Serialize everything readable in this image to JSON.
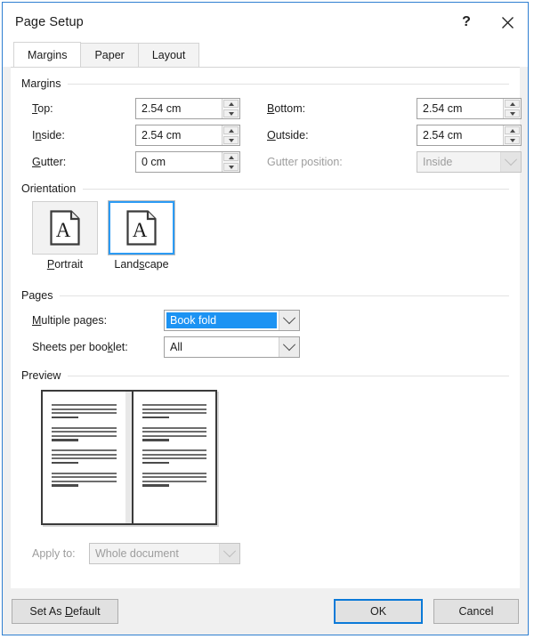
{
  "window": {
    "title": "Page Setup",
    "help_label": "?",
    "close_label": "✕"
  },
  "tabs": [
    {
      "label": "Margins",
      "active": true
    },
    {
      "label": "Paper",
      "active": false
    },
    {
      "label": "Layout",
      "active": false
    }
  ],
  "margins_group": {
    "title": "Margins",
    "fields": {
      "top": {
        "label_pre": "T",
        "label_key": "",
        "label": "Top:",
        "value": "2.54 cm"
      },
      "bottom": {
        "label": "Bottom:",
        "value": "2.54 cm"
      },
      "inside": {
        "label": "Inside:",
        "value": "2.54 cm"
      },
      "outside": {
        "label": "Outside:",
        "value": "2.54 cm"
      },
      "gutter": {
        "label": "Gutter:",
        "value": "0 cm"
      },
      "gutter_position": {
        "label": "Gutter position:",
        "value": "Inside",
        "enabled": false
      }
    }
  },
  "orientation_group": {
    "title": "Orientation",
    "options": [
      {
        "label": "Portrait",
        "selected": false,
        "glyph": "A"
      },
      {
        "label": "Landscape",
        "selected": true,
        "glyph": "A"
      }
    ]
  },
  "pages_group": {
    "title": "Pages",
    "multiple_pages": {
      "label": "Multiple pages:",
      "value": "Book fold",
      "selected": true
    },
    "sheets_per_booklet": {
      "label": "Sheets per booklet:",
      "value": "All",
      "selected": false
    }
  },
  "preview_group": {
    "title": "Preview",
    "paragraphs": [
      {
        "lines": 3,
        "short_last": true
      },
      {
        "lines": 3,
        "short_last": true
      },
      {
        "lines": 3,
        "short_last": true
      },
      {
        "lines": 3,
        "short_last": true
      }
    ]
  },
  "apply_to": {
    "label": "Apply to:",
    "value": "Whole document",
    "enabled": false
  },
  "buttons": {
    "set_as_default": "Set As Default",
    "ok": "OK",
    "cancel": "Cancel"
  },
  "colors": {
    "accent_blue": "#1c93f3",
    "focus_blue": "#0b7ad8",
    "dialog_border": "#2f7fd1"
  }
}
